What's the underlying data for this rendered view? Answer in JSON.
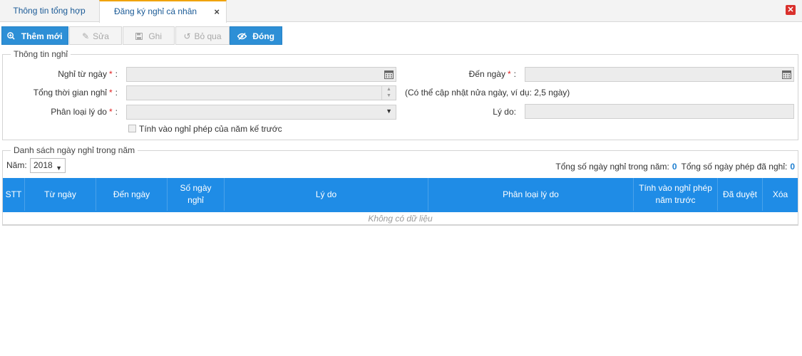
{
  "tabs": [
    {
      "label": "Thông tin tổng hợp"
    },
    {
      "label": "Đăng ký nghỉ cá nhân"
    }
  ],
  "icons": {
    "tab_close": "×",
    "window_close": "✕",
    "add": "⊕",
    "edit": "✎",
    "save": "save-icon",
    "skip": "↺",
    "close": "eye-slash-icon"
  },
  "toolbar": {
    "add_label": "Thêm mới",
    "edit_label": "Sửa",
    "save_label": "Ghi",
    "skip_label": "Bỏ qua",
    "close_label": "Đóng"
  },
  "leave_info": {
    "legend": "Thông tin nghỉ",
    "from_date_label": "Nghỉ từ ngày",
    "from_date_value": "",
    "to_date_label": "Đến ngày",
    "to_date_value": "",
    "duration_label": "Tổng thời gian nghỉ",
    "duration_value": "",
    "duration_note": "(Có thể cập nhật nửa ngày, ví dụ: 2,5 ngày)",
    "reason_type_label": "Phân loại lý do",
    "reason_type_value": "",
    "reason_label": "Lý do:",
    "reason_value": "",
    "required_mark": "*",
    "colon": ":",
    "prior_year_checkbox_label": "Tính vào nghỉ phép của năm kế trước",
    "prior_year_checked": false
  },
  "leave_list": {
    "legend": "Danh sách ngày nghỉ trong năm",
    "year_label": "Năm:",
    "year_value": "2018",
    "total_days_label": "Tổng số ngày nghỉ trong năm:",
    "total_days_value": "0",
    "total_leave_label": "Tổng số ngày phép đã nghỉ:",
    "total_leave_value": "0",
    "columns": [
      "STT",
      "Từ ngày",
      "Đến ngày",
      "Số ngày nghỉ",
      "Lý do",
      "Phân loại lý do",
      "Tính vào nghỉ phép năm trước",
      "Đã duyệt",
      "Xóa"
    ],
    "empty_text": "Không có dữ liệu"
  },
  "colors": {
    "accent": "#2d8fd6",
    "grid_header": "#1f8ce6",
    "tab_active_border": "#f0a30a",
    "required": "#e02020",
    "window_close": "#d9302c"
  }
}
